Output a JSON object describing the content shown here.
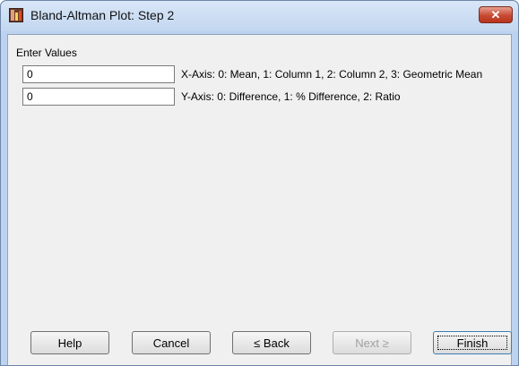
{
  "window": {
    "title": "Bland-Altman Plot: Step 2",
    "close_glyph": "✕"
  },
  "form": {
    "heading": "Enter Values",
    "fields": [
      {
        "value": "0",
        "label": "X-Axis: 0: Mean, 1: Column 1, 2: Column 2, 3: Geometric Mean"
      },
      {
        "value": "0",
        "label": "Y-Axis: 0: Difference, 1: % Difference, 2: Ratio"
      }
    ]
  },
  "buttons": {
    "help": "Help",
    "cancel": "Cancel",
    "back": "≤ Back",
    "next": "Next ≥",
    "finish": "Finish"
  },
  "icons": {
    "app": "bland-altman-app-icon",
    "close": "close-icon"
  },
  "colors": {
    "titlebar": "#c2d7f0",
    "close_button": "#c74a32",
    "client_background": "#f0f0f0",
    "disabled_text": "#a0a0a0"
  }
}
